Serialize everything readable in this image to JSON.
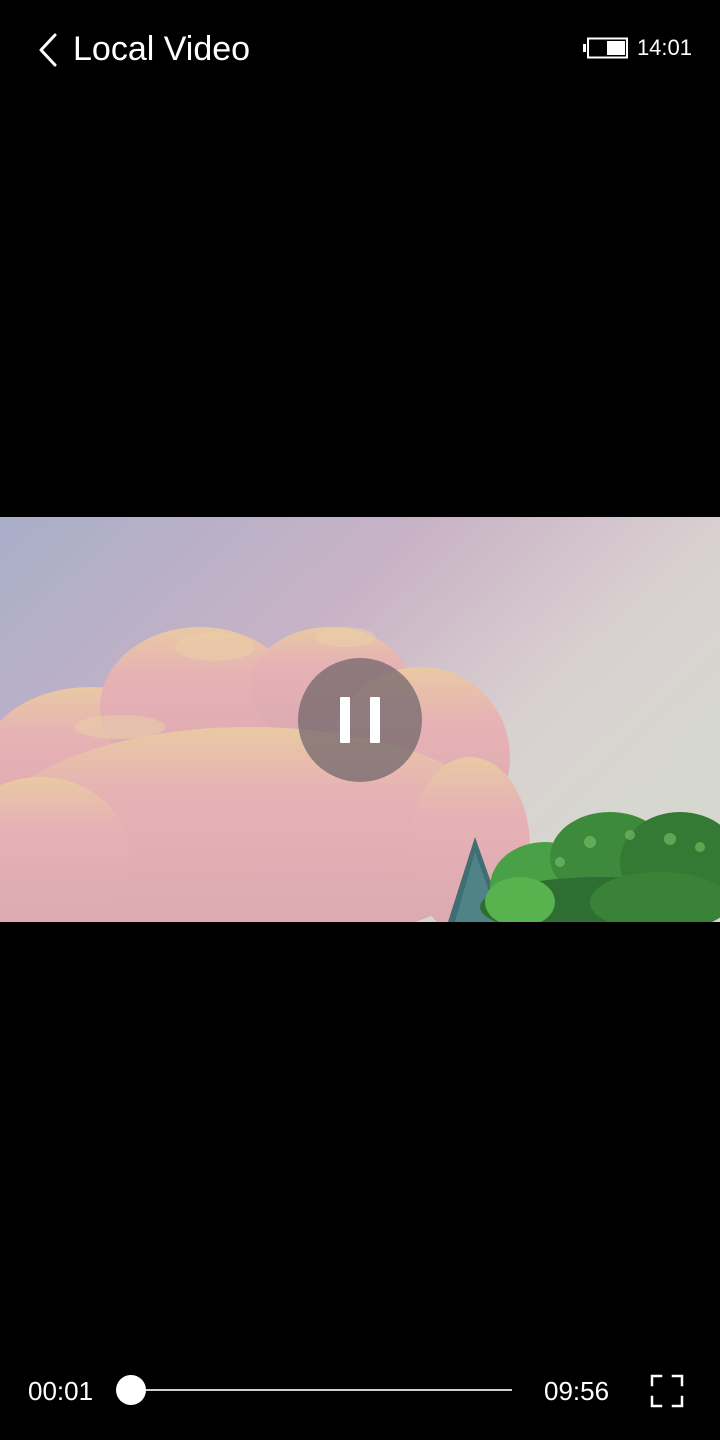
{
  "header": {
    "title": "Local Video",
    "back_icon": "chevron-left-icon"
  },
  "status_bar": {
    "time": "14:01",
    "battery_icon": "battery-icon",
    "battery_level": 0.5
  },
  "player": {
    "state_icon": "pause-icon",
    "current_time": "00:01",
    "total_time": "09:56",
    "progress": 0.002,
    "fullscreen_icon": "fullscreen-icon"
  },
  "colors": {
    "background": "#000000",
    "overlay_button": "#6e6469",
    "track": "#cfcfcf",
    "text": "#ffffff"
  }
}
